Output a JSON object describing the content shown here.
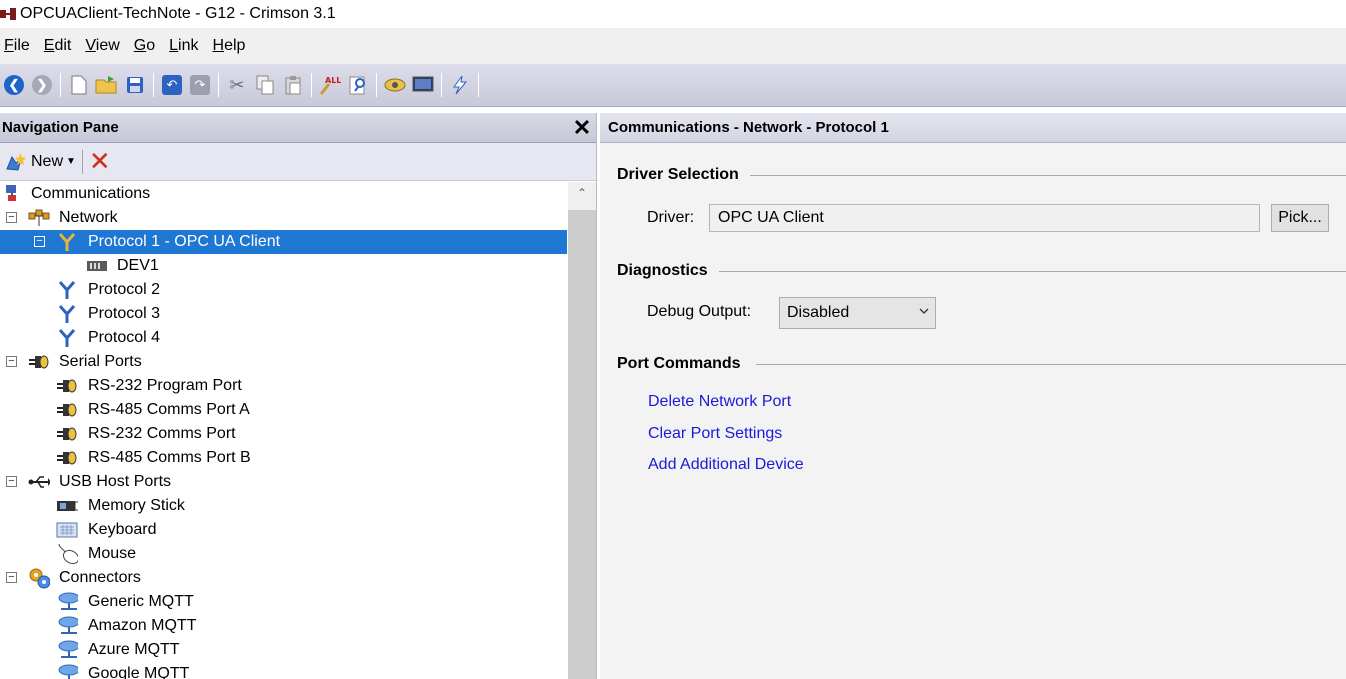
{
  "window": {
    "title": "OPCUAClient-TechNote - G12 - Crimson 3.1"
  },
  "menu": [
    {
      "label_rest": "ile",
      "key": "F"
    },
    {
      "label_rest": "dit",
      "key": "E"
    },
    {
      "label_rest": "iew",
      "key": "V"
    },
    {
      "label_rest": "o",
      "key": "G"
    },
    {
      "label_rest": "ink",
      "key": "L"
    },
    {
      "label_rest": "elp",
      "key": "H"
    }
  ],
  "nav": {
    "title": "Navigation Pane",
    "new_label": "New",
    "tree": [
      {
        "label": "Communications",
        "icon": "communications-icon"
      },
      {
        "label": "Network",
        "icon": "network-icon"
      },
      {
        "label": "Protocol 1 - OPC UA Client",
        "icon": "protocol-icon"
      },
      {
        "label": "DEV1",
        "icon": "device-icon"
      },
      {
        "label": "Protocol 2",
        "icon": "protocol-icon"
      },
      {
        "label": "Protocol 3",
        "icon": "protocol-icon"
      },
      {
        "label": "Protocol 4",
        "icon": "protocol-icon"
      },
      {
        "label": "Serial Ports",
        "icon": "serial-port-icon"
      },
      {
        "label": "RS-232 Program Port",
        "icon": "serial-port-icon"
      },
      {
        "label": "RS-485 Comms Port A",
        "icon": "serial-port-icon"
      },
      {
        "label": "RS-232 Comms Port",
        "icon": "serial-port-icon"
      },
      {
        "label": "RS-485 Comms Port B",
        "icon": "serial-port-icon"
      },
      {
        "label": "USB Host Ports",
        "icon": "usb-icon"
      },
      {
        "label": "Memory Stick",
        "icon": "memory-stick-icon"
      },
      {
        "label": "Keyboard",
        "icon": "keyboard-icon"
      },
      {
        "label": "Mouse",
        "icon": "mouse-icon"
      },
      {
        "label": "Connectors",
        "icon": "connectors-icon"
      },
      {
        "label": "Generic MQTT",
        "icon": "cloud-icon"
      },
      {
        "label": "Amazon MQTT",
        "icon": "cloud-icon"
      },
      {
        "label": "Azure MQTT",
        "icon": "cloud-icon"
      },
      {
        "label": "Google MQTT",
        "icon": "cloud-icon"
      }
    ]
  },
  "main": {
    "header": "Communications - Network - Protocol 1",
    "driver_section": "Driver Selection",
    "driver_label": "Driver:",
    "driver_value": "OPC UA Client",
    "pick_label": "Pick...",
    "diagnostics_section": "Diagnostics",
    "debug_label": "Debug Output:",
    "debug_value": "Disabled",
    "port_section": "Port Commands",
    "links": [
      "Delete Network Port",
      "Clear Port Settings",
      "Add Additional Device"
    ]
  },
  "colors": {
    "selection": "#1e77d3",
    "link": "#1a1ad8",
    "delete": "#d42a1b"
  }
}
